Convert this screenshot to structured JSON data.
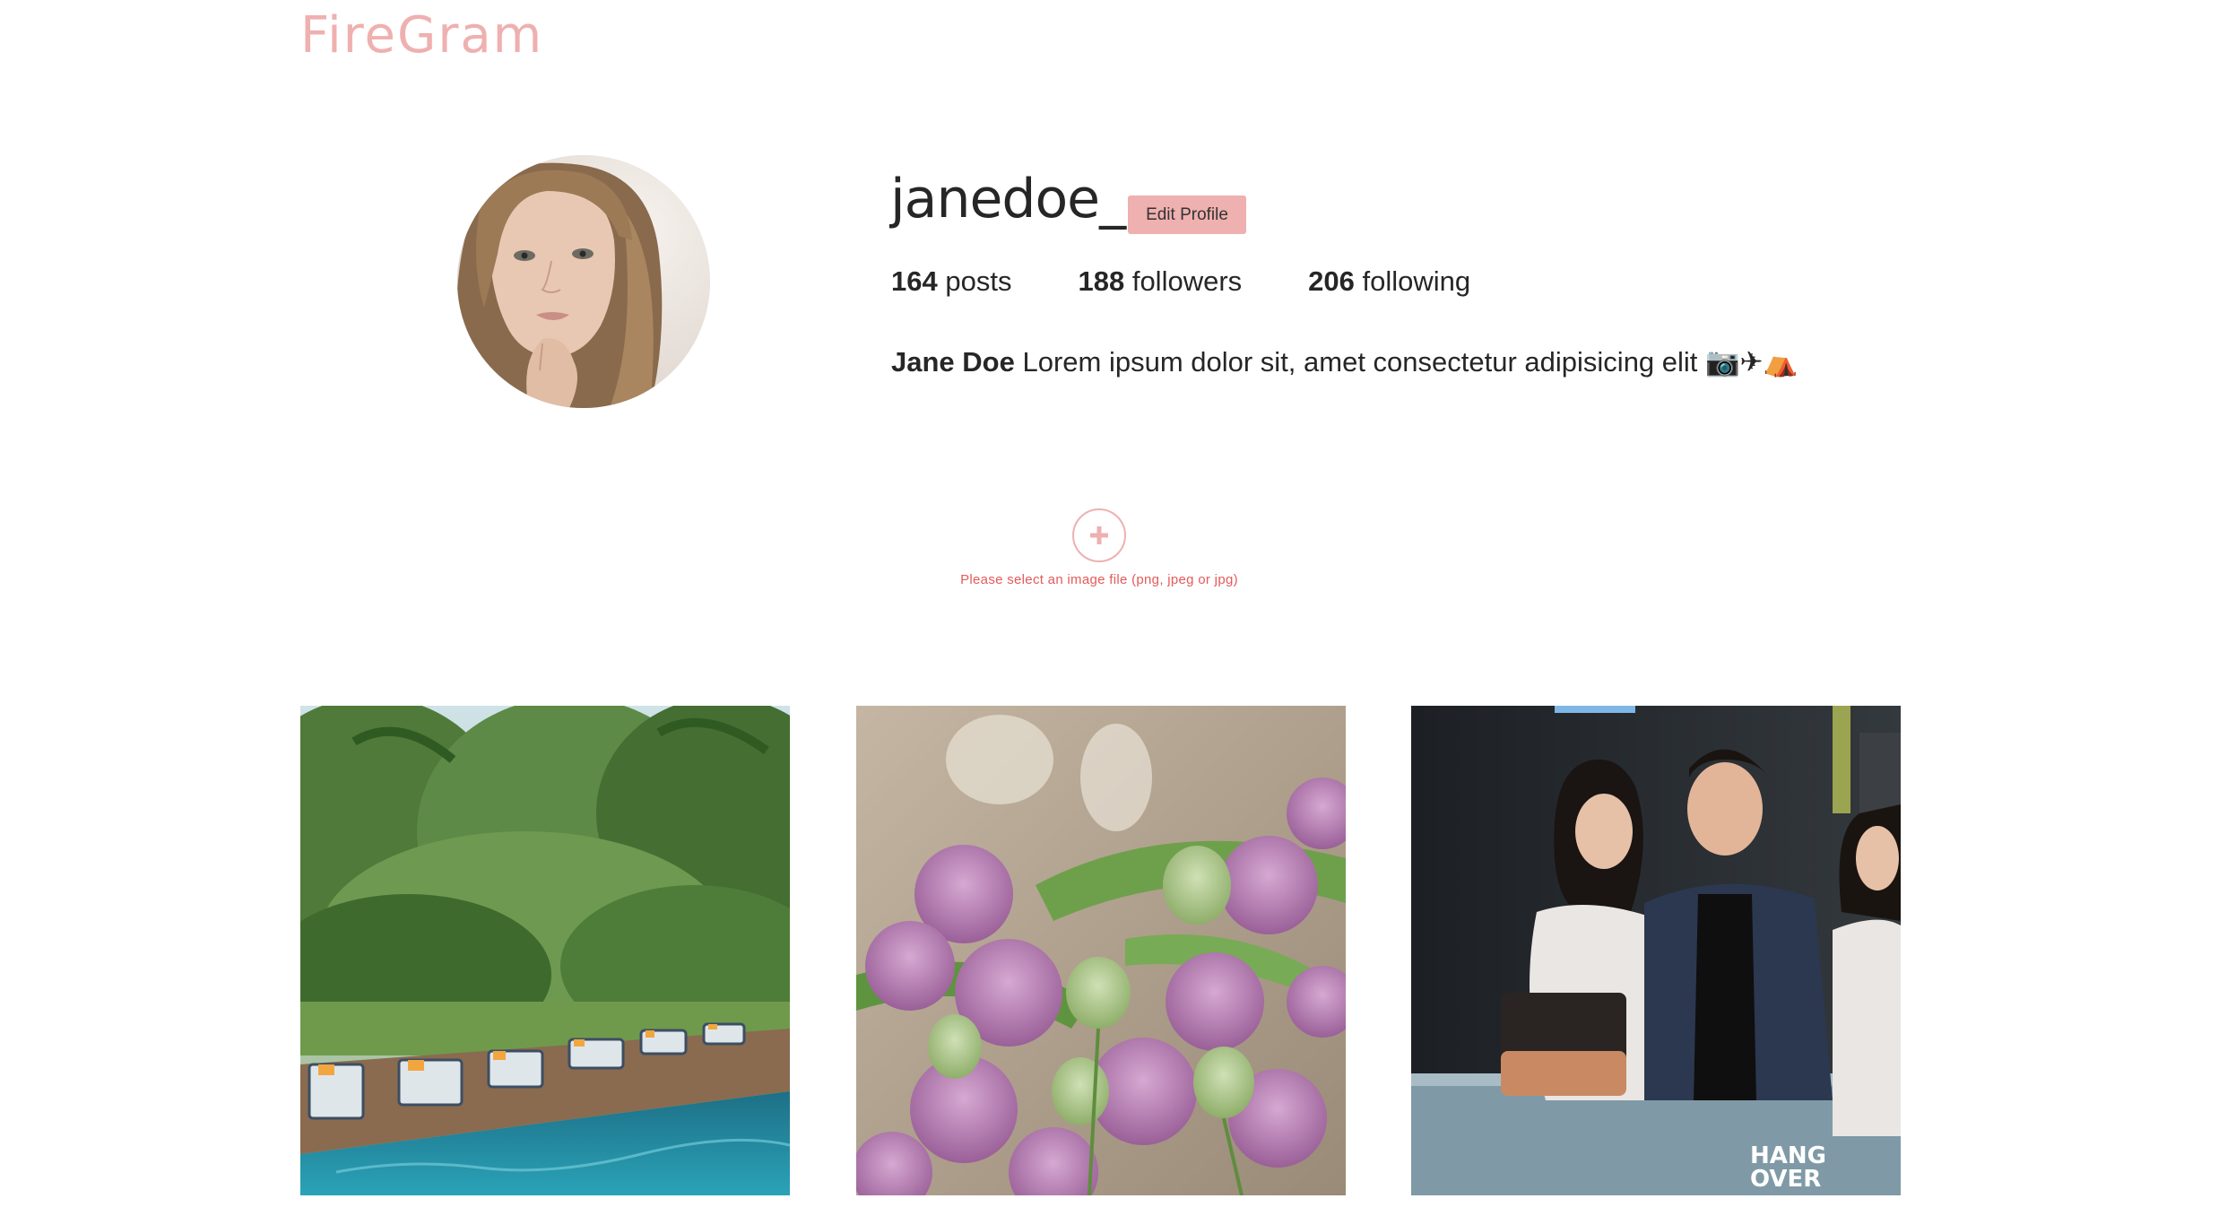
{
  "app": {
    "logo": "FireGram",
    "brand_color": "#efb0b0"
  },
  "profile": {
    "username": "janedoe_",
    "edit_label": "Edit Profile",
    "stats": {
      "posts_count": "164",
      "posts_label": "posts",
      "followers_count": "188",
      "followers_label": "followers",
      "following_count": "206",
      "following_label": "following"
    },
    "bio_name": "Jane Doe",
    "bio_text": "Lorem ipsum dolor sit, amet consectetur adipisicing elit 📷✈⛺"
  },
  "upload": {
    "icon": "plus-icon",
    "message": "Please select an image file (png, jpeg or jpg)",
    "message_color": "#e35b5b"
  },
  "posts": [
    {
      "alt": "resort pool with palm trees and loungers"
    },
    {
      "alt": "bouquet of purple tulips"
    },
    {
      "alt": "three friends posing at a party"
    }
  ]
}
